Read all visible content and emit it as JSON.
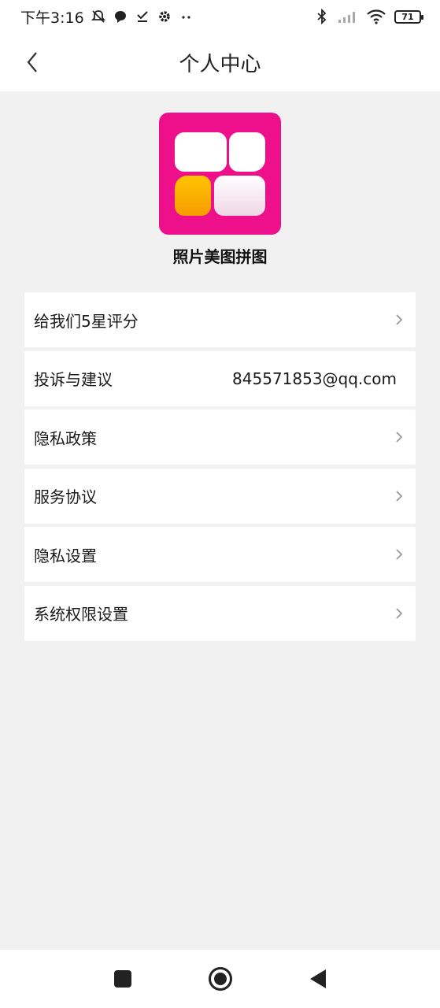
{
  "status_bar": {
    "time": "下午3:16",
    "battery": "71",
    "icons": [
      "mute-icon",
      "chat-icon",
      "check-icon",
      "gear-icon",
      "more-dots-icon",
      "bluetooth-icon",
      "signal-icon",
      "wifi-icon",
      "battery-icon"
    ]
  },
  "header": {
    "title": "个人中心",
    "back_icon": "chevron-left-icon"
  },
  "app": {
    "name": "照片美图拼图",
    "logo_colors": {
      "background": "#ee0f8a",
      "tile": "#ffffff",
      "accent_top": "#ffc400",
      "accent_bottom": "#f79c00"
    }
  },
  "menu": {
    "items": [
      {
        "label": "给我们5星评分",
        "value": ""
      },
      {
        "label": "投诉与建议",
        "value": "845571853@qq.com"
      },
      {
        "label": "隐私政策",
        "value": ""
      },
      {
        "label": "服务协议",
        "value": ""
      },
      {
        "label": "隐私设置",
        "value": ""
      },
      {
        "label": "系统权限设置",
        "value": ""
      }
    ]
  },
  "nav": {
    "icons": [
      "recents-square-icon",
      "home-circle-icon",
      "back-triangle-icon"
    ]
  }
}
